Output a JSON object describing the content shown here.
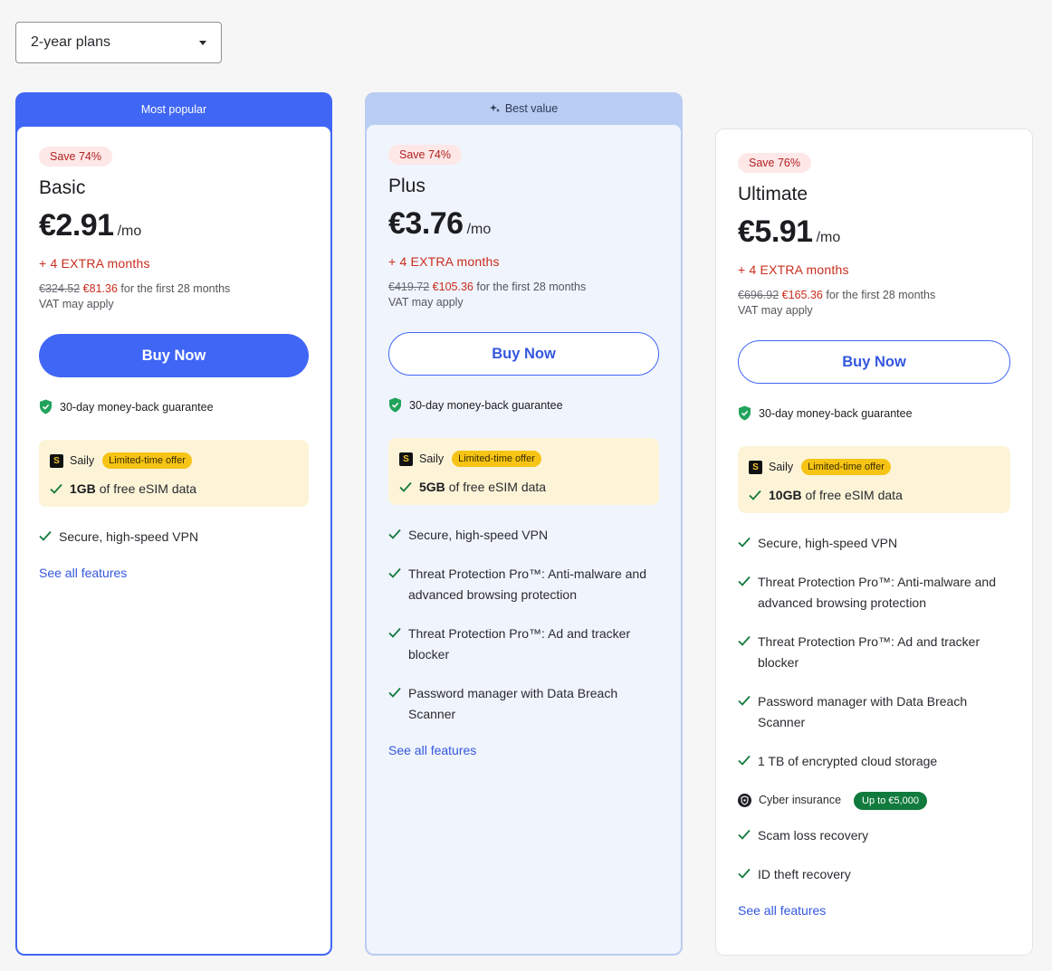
{
  "period_select": {
    "value": "2-year plans",
    "icon": "caret-down-icon"
  },
  "colors": {
    "accent": "#4066f5",
    "save_red": "#c92d1e",
    "check_green": "#117a3d",
    "offer_yellow": "#f6c415"
  },
  "plans": [
    {
      "banner": "Most popular",
      "save": "Save 74%",
      "name": "Basic",
      "price": "€2.91",
      "per": "/mo",
      "extra": "+ 4 EXTRA months",
      "old_price": "€324.52",
      "new_price": "€81.36",
      "term": "for the first 28 months",
      "vat": "VAT may apply",
      "buy_label": "Buy Now",
      "guarantee": "30-day money-back guarantee",
      "saily": {
        "name": "Saily",
        "badge": "Limited-time offer",
        "amount": "1GB",
        "text": "of free eSIM data"
      },
      "features": [
        "Secure, high-speed VPN"
      ],
      "see_all": "See all features"
    },
    {
      "banner": "Best value",
      "save": "Save 74%",
      "name": "Plus",
      "price": "€3.76",
      "per": "/mo",
      "extra": "+ 4 EXTRA months",
      "old_price": "€419.72",
      "new_price": "€105.36",
      "term": "for the first 28 months",
      "vat": "VAT may apply",
      "buy_label": "Buy Now",
      "guarantee": "30-day money-back guarantee",
      "saily": {
        "name": "Saily",
        "badge": "Limited-time offer",
        "amount": "5GB",
        "text": "of free eSIM data"
      },
      "features": [
        "Secure, high-speed VPN",
        "Threat Protection Pro™: Anti-malware and advanced browsing protection",
        "Threat Protection Pro™: Ad and tracker blocker",
        "Password manager with Data Breach Scanner"
      ],
      "see_all": "See all features"
    },
    {
      "save": "Save 76%",
      "name": "Ultimate",
      "price": "€5.91",
      "per": "/mo",
      "extra": "+ 4 EXTRA months",
      "old_price": "€696.92",
      "new_price": "€165.36",
      "term": "for the first 28 months",
      "vat": "VAT may apply",
      "buy_label": "Buy Now",
      "guarantee": "30-day money-back guarantee",
      "saily": {
        "name": "Saily",
        "badge": "Limited-time offer",
        "amount": "10GB",
        "text": "of free eSIM data"
      },
      "features": [
        "Secure, high-speed VPN",
        "Threat Protection Pro™: Anti-malware and advanced browsing protection",
        "Threat Protection Pro™: Ad and tracker blocker",
        "Password manager with Data Breach Scanner",
        "1 TB of encrypted cloud storage"
      ],
      "insurance": {
        "label": "Cyber insurance",
        "badge": "Up to €5,000"
      },
      "features_after": [
        "Scam loss recovery",
        "ID theft recovery"
      ],
      "see_all": "See all features"
    }
  ]
}
